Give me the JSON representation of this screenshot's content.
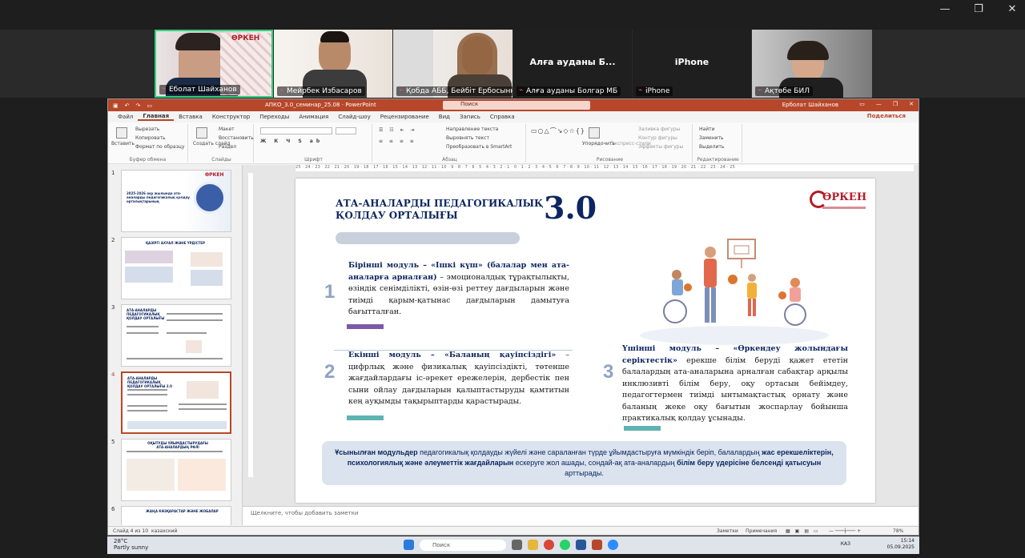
{
  "window": {
    "controls": [
      "—",
      "❐",
      "✕"
    ]
  },
  "participants": [
    {
      "name": "Еболат Шайханов",
      "video": true
    },
    {
      "name": "Мейрбек Избасаров",
      "video": true
    },
    {
      "name": "Қобда АББ, Бейбіт Ербосынқызы",
      "video": true
    },
    {
      "name": "Алға ауданы Болгар МБ",
      "label": "Алға ауданы Б...",
      "video": false
    },
    {
      "name": "iPhone",
      "label": "iPhone",
      "video": false
    },
    {
      "name": "Ақтөбе БИЛ",
      "video": true
    }
  ],
  "ppt": {
    "doc_title": "АПКО_3.0_семинар_25.08",
    "app": "PowerPoint",
    "search": "Поиск",
    "user": "Ерболат Шайханов",
    "share": "Поделиться",
    "tabs": [
      "Файл",
      "Главная",
      "Вставка",
      "Конструктор",
      "Переходы",
      "Анимация",
      "Слайд-шоу",
      "Рецензирование",
      "Вид",
      "Запись",
      "Справка"
    ],
    "ribbon": {
      "paste": "Вставить",
      "cut": "Вырезать",
      "copy": "Копировать",
      "format_painter": "Формат по образцу",
      "clipboard": "Буфер обмена",
      "new_slide": "Создать слайд",
      "layout": "Макет",
      "reset": "Восстановить",
      "section": "Раздел",
      "slides": "Слайды",
      "font": "Шрифт",
      "text_direction": "Направление текста",
      "align_text": "Выровнять текст",
      "smartart": "Преобразовать в SmartArt",
      "paragraph": "Абзац",
      "arrange": "Упорядочить",
      "quick_styles": "Экспресс-стили",
      "fill": "Заливка фигуры",
      "outline": "Контур фигуры",
      "effects": "Эффекты фигуры",
      "drawing": "Рисование",
      "find": "Найти",
      "replace": "Заменить",
      "select": "Выделить",
      "editing": "Редактирование"
    },
    "ruler": "25 · 24 · 23 · 22 · 21 · 20 · 19 · 18 · 17 · 16 · 15 · 14 · 13 · 12 · 11 · 10 · 9 · 8 · 7 · 6 · 5 · 4 · 3 · 2 · 1 · 0 · 1 · 2 · 3 · 4 · 5 · 6 · 7 · 8 · 9 · 10 · 11 · 12 · 13 · 14 · 15 · 16 · 17 · 18 · 19 · 20 · 21 · 22 · 23 · 24 · 25",
    "notes_placeholder": "Щелкните, чтобы добавить заметки",
    "status": {
      "slide": "Слайд 4 из 10",
      "language": "казахский",
      "notes": "Заметки",
      "comments": "Примечания",
      "zoom": "78%"
    },
    "thumbnails": [
      {
        "num": "1",
        "caption": "2025-2026 оқу жылында ата-аналарды педагогикалық қолдау орталықтарының"
      },
      {
        "num": "2",
        "caption": "ҚАЗІРГІ АХУАЛ ЖӘНЕ ҮРДІСТЕР"
      },
      {
        "num": "3",
        "caption": "АТА-АНАЛАРДЫ ПЕДАГОГИКАЛЫҚ ҚОЛДАУ ОРТАЛЫҒЫ"
      },
      {
        "num": "4",
        "caption": "АТА-АНАЛАРДЫ ПЕДАГОГИКАЛЫҚ ҚОЛДАУ ОРТАЛЫҒЫ 3.0"
      },
      {
        "num": "5",
        "caption": "ОҚЫТУДЫ ҰЙЫМДАСТЫРУДАҒЫ АТА-АНАЛАРДЫҢ РӨЛІ"
      },
      {
        "num": "6",
        "caption": "ЖАҢА КӨЗҚАРАСТАР ЖӘНЕ ЖОБАЛАР"
      }
    ],
    "slide": {
      "title": "АТА-АНАЛАРДЫ ПЕДАГОГИКАЛЫҚ ҚОЛДАУ ОРТАЛЫҒЫ",
      "version": "3.0",
      "logo": "ӨРКЕН",
      "modules": [
        {
          "num": "1",
          "bold": "Бірінші модуль – «Ішкі күш» (балалар мен ата-аналарға арналған)",
          "text": " – эмоционалдық тұрақтылықты, өзіндік сенімділікті, өзін-өзі реттеу дағдыларын және тиімді қарым-қатынас дағдыларын дамытуға бағытталған."
        },
        {
          "num": "2",
          "bold": "Екінші модуль – «Баланың қауіпсіздігі»",
          "text": " – цифрлық және физикалық қауіпсіздікті, төтенше жағдайлардағы іс-әрекет ережелерін, дербестік пен сыни ойлау дағдыларын қалыптастыруды қамтитын кең ауқымды тақырыптарды қарастырады."
        },
        {
          "num": "3",
          "bold": "Үшінші модуль – «Өркендеу жолындағы серіктестік»",
          "text": " ерекше білім беруді қажет ететін балалардың ата-аналарына арналған сабақтар арқылы инклюзивті білім беру, оқу ортасын бейімдеу, педагогтермен тиімді ынтымақтастық орнату және баланың жеке оқу бағытын жоспарлау бойынша практикалық қолдау ұсынады."
        }
      ],
      "summary": {
        "part1": "Ұсынылған модульдер",
        "part2": " педагогикалық қолдауды жүйелі және сараланған түрде ұйымдастыруға мүмкіндік беріп, балалардың ",
        "part3": "жас ерекшеліктерін, психологиялық және әлеуметтік жағдайларын",
        "part4": " ескеруге жол ашады, сондай-ақ ата-аналардың ",
        "part5": "білім беру үдерісіне белсенді қатысуын",
        "part6": " арттырады."
      }
    },
    "colors": {
      "accent": "#b7472a",
      "navy": "#0d2660",
      "purple": "#7b5aa6",
      "teal": "#5fb3b3"
    }
  },
  "taskbar": {
    "temp": "28°C",
    "weather": "Partly sunny",
    "search": "Поиск",
    "lang": "КАЗ",
    "time": "15:14",
    "date": "05.09.2025"
  }
}
